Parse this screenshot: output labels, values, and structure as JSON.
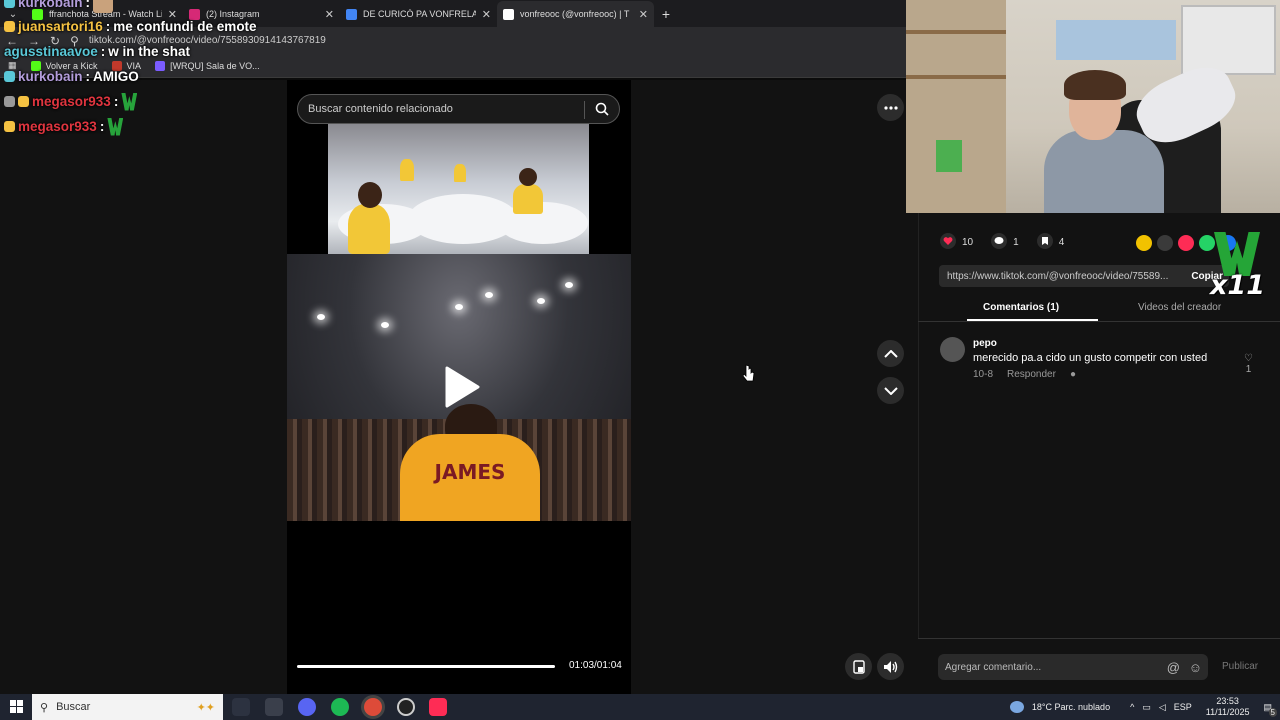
{
  "browser": {
    "tabs": [
      {
        "label": "ffranchota Stream - Watch Live",
        "favicon_color": "#53fc18"
      },
      {
        "label": "(2) Instagram",
        "favicon_color": "#d62976"
      },
      {
        "label": "DE CURICÓ PA VONFRELANDIA",
        "favicon_color": "#4285f4"
      },
      {
        "label": "vonfreooc (@vonfreooc) | T",
        "favicon_color": "#ffffff"
      }
    ],
    "url": "tiktok.com/@vonfreooc/video/7558930914143767819",
    "bookmarks": [
      {
        "label": "Volver a Kick",
        "color": "#53fc18"
      },
      {
        "label": "VIA",
        "color": "#c0392b"
      },
      {
        "label": "[WRQU] Sala de VO...",
        "color": "#7b5cff"
      }
    ]
  },
  "chat": {
    "messages": [
      {
        "user": "kurkobain",
        "user_color": "#b39ddb",
        "text": ""
      },
      {
        "user": "juansartori16",
        "user_color": "#f5c242",
        "text": "me confundi de emote"
      },
      {
        "user": "agusstinaavoe",
        "user_color": "#5ac8d8",
        "text": "w in the shat"
      },
      {
        "user": "kurkobain",
        "user_color": "#b39ddb",
        "text": "AMIGO"
      },
      {
        "user": "megasor933",
        "user_color": "#e0353f",
        "text": ""
      },
      {
        "user": "megasor933",
        "user_color": "#e0353f",
        "text": ""
      }
    ]
  },
  "tiktok": {
    "search_placeholder": "Buscar contenido relacionado",
    "time": "01:03/01:04",
    "progress": 0.98,
    "actions": {
      "likes": "10",
      "comments": "1",
      "saves": "4"
    },
    "share_url": "https://www.tiktok.com/@vonfreooc/video/75589...",
    "copy_label": "Copiar",
    "tab_comments": "Comentarios (1)",
    "tab_videos": "Videos del creador",
    "comment": {
      "user": "pepo",
      "text": "merecido pa.a cido un gusto competir con usted",
      "date": "10-8",
      "reply": "Responder",
      "likes": "1"
    },
    "add_comment_placeholder": "Agregar comentario...",
    "publish": "Publicar"
  },
  "video": {
    "jersey_name": "JAMES"
  },
  "overlay": {
    "multiplier": "x11"
  },
  "taskbar": {
    "search": "Buscar",
    "weather": "18°C  Parc. nublado",
    "lang": "ESP",
    "time": "23:53",
    "date": "11/11/2025",
    "notifications": "5"
  }
}
